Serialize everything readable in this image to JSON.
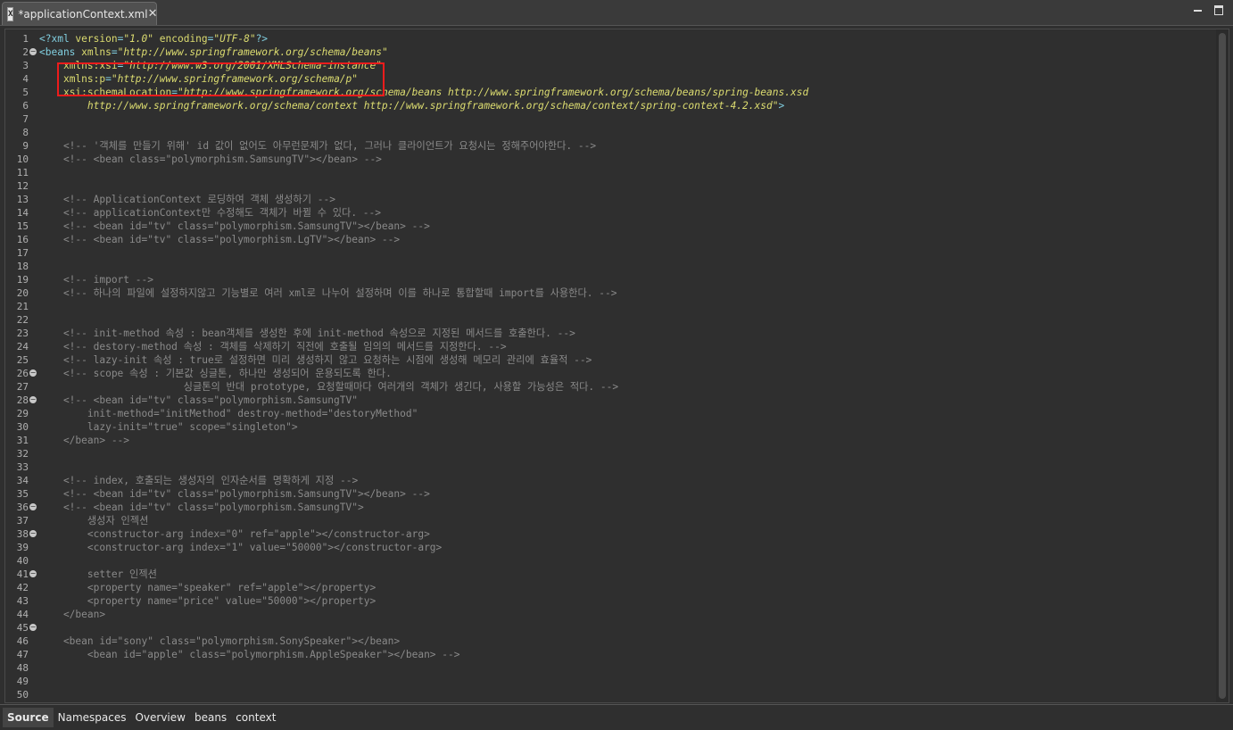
{
  "tab": {
    "title": "*applicationContext.xml",
    "icon": "xml-file-icon",
    "icon_glyph": "X",
    "close_glyph": "✕"
  },
  "lines": [
    {
      "n": "1",
      "fold": false,
      "parts": [
        {
          "c": "c-pi",
          "t": "<?xml "
        },
        {
          "c": "c-attr",
          "t": "version"
        },
        {
          "c": "c-pi",
          "t": "="
        },
        {
          "c": "c-str",
          "t": "\"1.0\""
        },
        {
          "c": "c-pi",
          "t": " "
        },
        {
          "c": "c-attr",
          "t": "encoding"
        },
        {
          "c": "c-pi",
          "t": "="
        },
        {
          "c": "c-str",
          "t": "\"UTF-8\""
        },
        {
          "c": "c-pi",
          "t": "?>"
        }
      ]
    },
    {
      "n": "2",
      "fold": true,
      "parts": [
        {
          "c": "c-tag",
          "t": "<beans "
        },
        {
          "c": "c-attr",
          "t": "xmlns"
        },
        {
          "c": "c-tag",
          "t": "="
        },
        {
          "c": "c-str",
          "t": "\"http://www.springframework.org/schema/beans\""
        }
      ]
    },
    {
      "n": "3",
      "fold": false,
      "parts": [
        {
          "c": "c-tag",
          "t": "    "
        },
        {
          "c": "c-attr",
          "t": "xmlns:xsi"
        },
        {
          "c": "c-tag",
          "t": "="
        },
        {
          "c": "c-str",
          "t": "\"http://www.w3.org/2001/XMLSchema-instance\""
        }
      ]
    },
    {
      "n": "4",
      "fold": false,
      "parts": [
        {
          "c": "c-tag",
          "t": "    "
        },
        {
          "c": "c-attr",
          "t": "xmlns:p"
        },
        {
          "c": "c-tag",
          "t": "="
        },
        {
          "c": "c-str",
          "t": "\"http://www.springframework.org/schema/p\""
        }
      ]
    },
    {
      "n": "5",
      "fold": false,
      "parts": [
        {
          "c": "c-tag",
          "t": "    "
        },
        {
          "c": "c-attr",
          "t": "xsi:schemaLocation"
        },
        {
          "c": "c-tag",
          "t": "="
        },
        {
          "c": "c-str",
          "t": "\"http://www.springframework.org/schema/beans http://www.springframework.org/schema/beans/spring-beans.xsd"
        }
      ]
    },
    {
      "n": "6",
      "fold": false,
      "parts": [
        {
          "c": "c-str",
          "t": "        http://www.springframework.org/schema/context http://www.springframework.org/schema/context/spring-context-4.2.xsd\""
        },
        {
          "c": "c-tag",
          "t": ">"
        }
      ]
    },
    {
      "n": "7",
      "fold": false,
      "parts": []
    },
    {
      "n": "8",
      "fold": false,
      "parts": []
    },
    {
      "n": "9",
      "fold": false,
      "parts": [
        {
          "c": "c-comment",
          "t": "    <!-- '객체를 만들기 위해' id 값이 없어도 아무런문제가 없다, 그러나 클라이언트가 요청시는 정해주어야한다. -->"
        }
      ]
    },
    {
      "n": "10",
      "fold": false,
      "parts": [
        {
          "c": "c-comment",
          "t": "    <!-- <bean class=\"polymorphism.SamsungTV\"></bean> -->"
        }
      ]
    },
    {
      "n": "11",
      "fold": false,
      "parts": []
    },
    {
      "n": "12",
      "fold": false,
      "parts": []
    },
    {
      "n": "13",
      "fold": false,
      "parts": [
        {
          "c": "c-comment",
          "t": "    <!-- ApplicationContext 로딩하여 객체 생성하기 -->"
        }
      ]
    },
    {
      "n": "14",
      "fold": false,
      "parts": [
        {
          "c": "c-comment",
          "t": "    <!-- applicationContext만 수정해도 객체가 바뀔 수 있다. -->"
        }
      ]
    },
    {
      "n": "15",
      "fold": false,
      "parts": [
        {
          "c": "c-comment",
          "t": "    <!-- <bean id=\"tv\" class=\"polymorphism.SamsungTV\"></bean> -->"
        }
      ]
    },
    {
      "n": "16",
      "fold": false,
      "parts": [
        {
          "c": "c-comment",
          "t": "    <!-- <bean id=\"tv\" class=\"polymorphism.LgTV\"></bean> -->"
        }
      ]
    },
    {
      "n": "17",
      "fold": false,
      "parts": []
    },
    {
      "n": "18",
      "fold": false,
      "parts": []
    },
    {
      "n": "19",
      "fold": false,
      "parts": [
        {
          "c": "c-comment",
          "t": "    <!-- import -->"
        }
      ]
    },
    {
      "n": "20",
      "fold": false,
      "parts": [
        {
          "c": "c-comment",
          "t": "    <!-- 하나의 파일에 설정하지않고 기능별로 여러 xml로 나누어 설정하며 이를 하나로 통합할때 import를 사용한다. -->"
        }
      ]
    },
    {
      "n": "21",
      "fold": false,
      "parts": []
    },
    {
      "n": "22",
      "fold": false,
      "parts": []
    },
    {
      "n": "23",
      "fold": false,
      "parts": [
        {
          "c": "c-comment",
          "t": "    <!-- init-method 속성 : bean객체를 생성한 후에 init-method 속성으로 지정된 메서드를 호출한다. -->"
        }
      ]
    },
    {
      "n": "24",
      "fold": false,
      "parts": [
        {
          "c": "c-comment",
          "t": "    <!-- destory-method 속성 : 객체를 삭제하기 직전에 호출될 임의의 메서드를 지정한다. -->"
        }
      ]
    },
    {
      "n": "25",
      "fold": false,
      "parts": [
        {
          "c": "c-comment",
          "t": "    <!-- lazy-init 속성 : true로 설정하면 미리 생성하지 않고 요청하는 시점에 생성해 메모리 관리에 효율적 -->"
        }
      ]
    },
    {
      "n": "26",
      "fold": true,
      "parts": [
        {
          "c": "c-comment",
          "t": "    <!-- scope 속성 : 기본값 싱글톤, 하나만 생성되어 운용되도록 한다."
        }
      ]
    },
    {
      "n": "27",
      "fold": false,
      "parts": [
        {
          "c": "c-comment",
          "t": "                        싱글톤의 반대 prototype, 요청할때마다 여러개의 객체가 생긴다, 사용할 가능성은 적다. -->"
        }
      ]
    },
    {
      "n": "28",
      "fold": true,
      "parts": [
        {
          "c": "c-comment",
          "t": "    <!-- <bean id=\"tv\" class=\"polymorphism.SamsungTV\""
        }
      ]
    },
    {
      "n": "29",
      "fold": false,
      "parts": [
        {
          "c": "c-comment",
          "t": "        init-method=\"initMethod\" destroy-method=\"destoryMethod\""
        }
      ]
    },
    {
      "n": "30",
      "fold": false,
      "parts": [
        {
          "c": "c-comment",
          "t": "        lazy-init=\"true\" scope=\"singleton\">"
        }
      ]
    },
    {
      "n": "31",
      "fold": false,
      "parts": [
        {
          "c": "c-comment",
          "t": "    </bean> -->"
        }
      ]
    },
    {
      "n": "32",
      "fold": false,
      "parts": []
    },
    {
      "n": "33",
      "fold": false,
      "parts": []
    },
    {
      "n": "34",
      "fold": false,
      "parts": [
        {
          "c": "c-comment",
          "t": "    <!-- index, 호출되는 생성자의 인자순서를 명확하게 지정 -->"
        }
      ]
    },
    {
      "n": "35",
      "fold": false,
      "parts": [
        {
          "c": "c-comment",
          "t": "    <!-- <bean id=\"tv\" class=\"polymorphism.SamsungTV\"></bean> -->"
        }
      ]
    },
    {
      "n": "36",
      "fold": true,
      "parts": [
        {
          "c": "c-comment",
          "t": "    <!-- <bean id=\"tv\" class=\"polymorphism.SamsungTV\">"
        }
      ]
    },
    {
      "n": "37",
      "fold": false,
      "parts": [
        {
          "c": "c-comment",
          "t": "        생성자 인젝션"
        }
      ]
    },
    {
      "n": "38",
      "fold": true,
      "parts": [
        {
          "c": "c-comment",
          "t": "        <constructor-arg index=\"0\" ref=\"apple\"></constructor-arg>"
        }
      ]
    },
    {
      "n": "39",
      "fold": false,
      "parts": [
        {
          "c": "c-comment",
          "t": "        <constructor-arg index=\"1\" value=\"50000\"></constructor-arg>"
        }
      ]
    },
    {
      "n": "40",
      "fold": false,
      "parts": []
    },
    {
      "n": "41",
      "fold": true,
      "parts": [
        {
          "c": "c-comment",
          "t": "        setter 인젝션"
        }
      ]
    },
    {
      "n": "42",
      "fold": false,
      "parts": [
        {
          "c": "c-comment",
          "t": "        <property name=\"speaker\" ref=\"apple\"></property>"
        }
      ]
    },
    {
      "n": "43",
      "fold": false,
      "parts": [
        {
          "c": "c-comment",
          "t": "        <property name=\"price\" value=\"50000\"></property>"
        }
      ]
    },
    {
      "n": "44",
      "fold": false,
      "parts": [
        {
          "c": "c-comment",
          "t": "    </bean>"
        }
      ]
    },
    {
      "n": "45",
      "fold": true,
      "parts": []
    },
    {
      "n": "46",
      "fold": false,
      "parts": [
        {
          "c": "c-comment",
          "t": "    <bean id=\"sony\" class=\"polymorphism.SonySpeaker\"></bean>"
        }
      ]
    },
    {
      "n": "47",
      "fold": false,
      "parts": [
        {
          "c": "c-comment",
          "t": "        <bean id=\"apple\" class=\"polymorphism.AppleSpeaker\"></bean> -->"
        }
      ]
    },
    {
      "n": "48",
      "fold": false,
      "parts": []
    },
    {
      "n": "49",
      "fold": false,
      "parts": []
    },
    {
      "n": "50",
      "fold": false,
      "parts": []
    }
  ],
  "bottom_tabs": [
    "Source",
    "Namespaces",
    "Overview",
    "beans",
    "context"
  ],
  "active_bottom_tab": "Source",
  "colors": {
    "highlight_box": "#ee1c1c",
    "background": "#2f2f2f"
  }
}
